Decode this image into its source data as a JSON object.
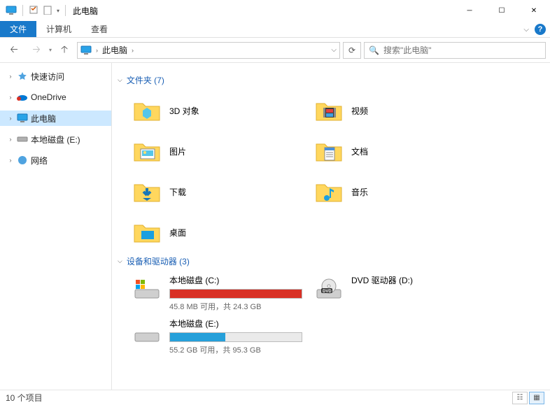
{
  "window": {
    "title": "此电脑"
  },
  "ribbon": {
    "file": "文件",
    "computer": "计算机",
    "view": "查看"
  },
  "nav": {
    "breadcrumb_root": "此电脑",
    "search_placeholder": "搜索\"此电脑\""
  },
  "sidebar": {
    "items": [
      {
        "label": "快速访问",
        "icon": "star"
      },
      {
        "label": "OneDrive",
        "icon": "onedrive"
      },
      {
        "label": "此电脑",
        "icon": "pc",
        "selected": true
      },
      {
        "label": "本地磁盘 (E:)",
        "icon": "drive"
      },
      {
        "label": "网络",
        "icon": "network"
      }
    ]
  },
  "groups": {
    "folders_header": "文件夹 (7)",
    "drives_header": "设备和驱动器 (3)"
  },
  "folders": [
    {
      "label": "3D 对象",
      "kind": "3d"
    },
    {
      "label": "视频",
      "kind": "video"
    },
    {
      "label": "图片",
      "kind": "pictures"
    },
    {
      "label": "文档",
      "kind": "docs"
    },
    {
      "label": "下载",
      "kind": "downloads"
    },
    {
      "label": "音乐",
      "kind": "music"
    },
    {
      "label": "桌面",
      "kind": "desktop"
    }
  ],
  "drives": [
    {
      "name": "本地磁盘 (C:)",
      "status": "45.8 MB 可用，共 24.3 GB",
      "fill_pct": 99.8,
      "color": "red",
      "icon": "win"
    },
    {
      "name": "DVD 驱动器 (D:)",
      "status": "",
      "fill_pct": null,
      "color": "",
      "icon": "dvd"
    },
    {
      "name": "本地磁盘 (E:)",
      "status": "55.2 GB 可用，共 95.3 GB",
      "fill_pct": 42,
      "color": "blue",
      "icon": "hdd"
    }
  ],
  "statusbar": {
    "count": "10 个项目"
  }
}
